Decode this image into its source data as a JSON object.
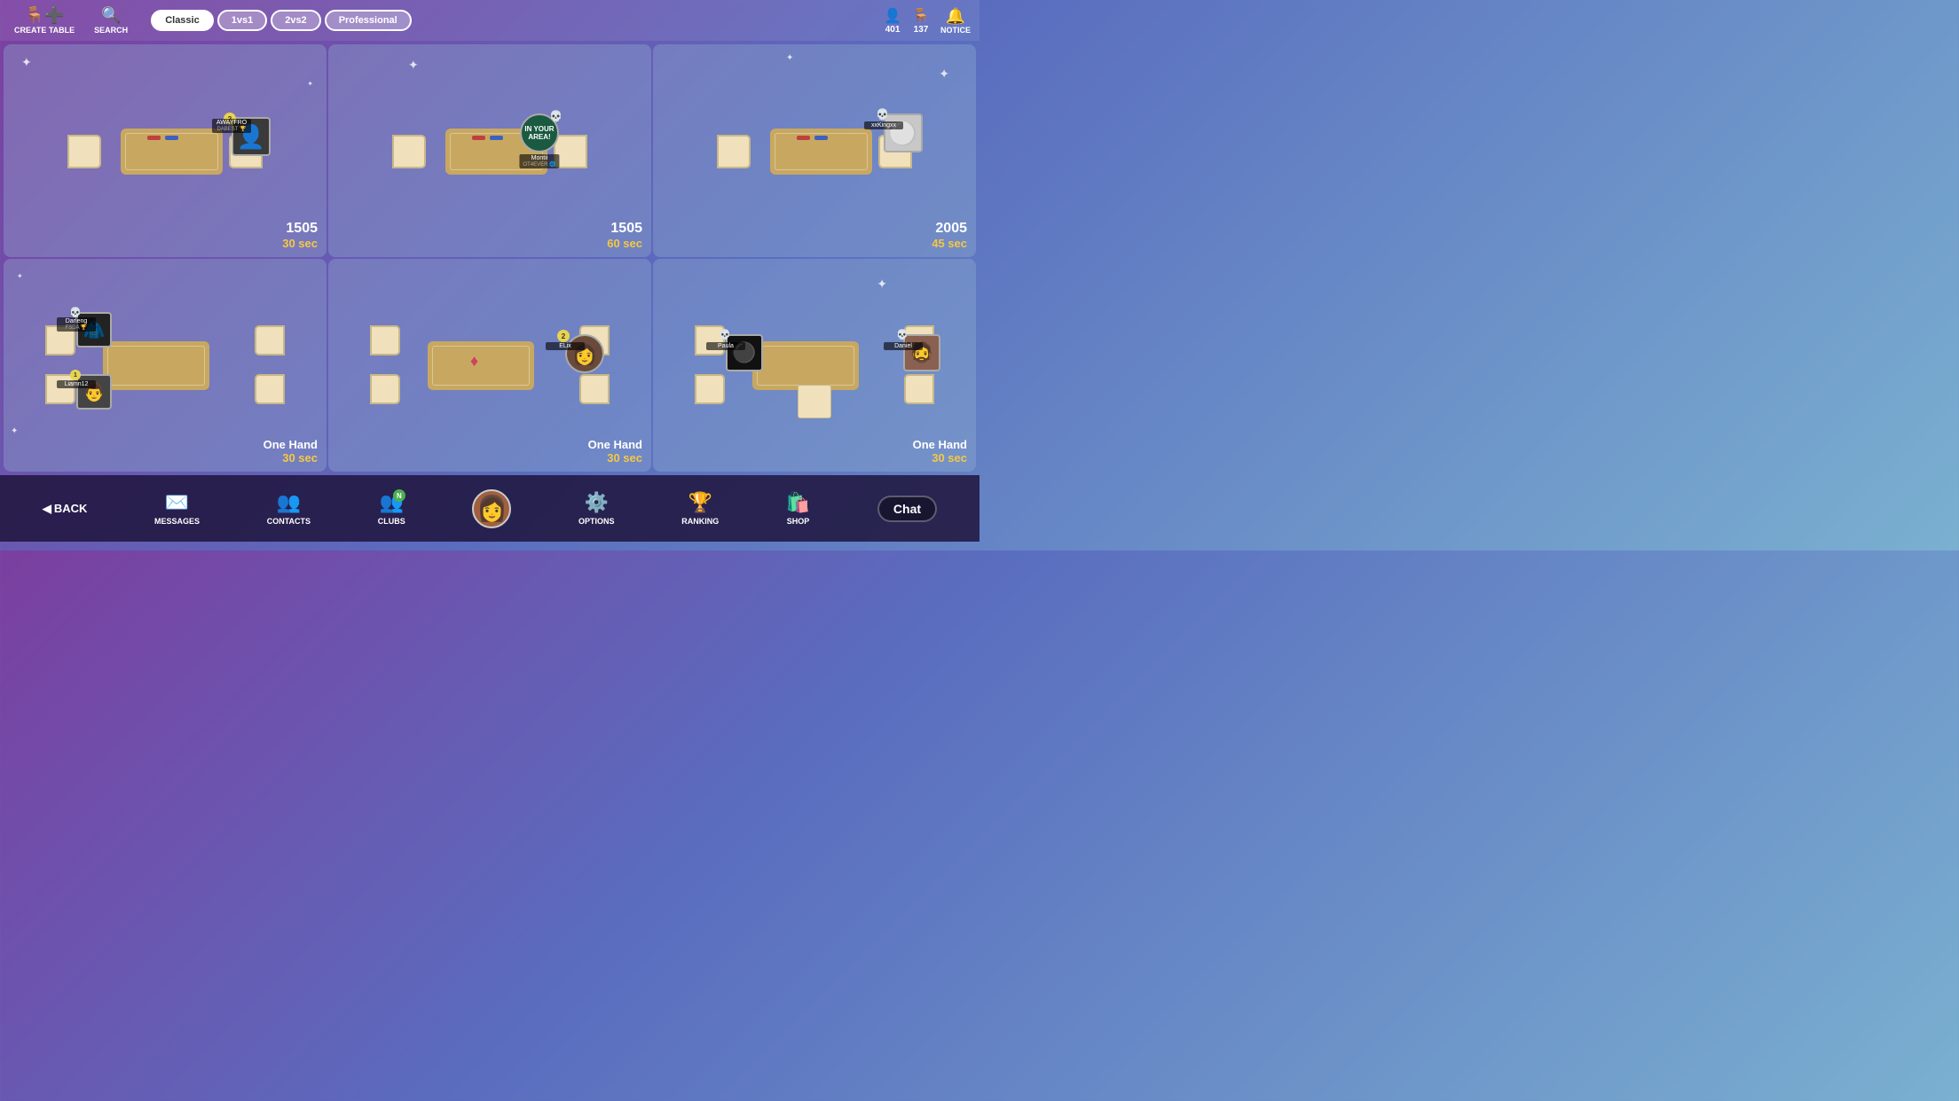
{
  "topBar": {
    "createTable": "CREATE TABLE",
    "search": "SEARCH",
    "modes": [
      "Classic",
      "1vs1",
      "2vs2",
      "Professional"
    ],
    "activeMode": "Classic",
    "friends": "401",
    "friendsIcon": "👤",
    "tables": "137",
    "tablesIcon": "🪑",
    "notice": "NOTICE",
    "noticeIcon": "🔔"
  },
  "tables": [
    {
      "id": "t1",
      "row": 0,
      "col": 0,
      "score": "1505",
      "time": "30 sec",
      "mode": "",
      "players": [
        {
          "name": "AWAYFRO",
          "subtitle": "DABEST",
          "pos": "right",
          "hasSkull": false,
          "badgeNum": 2,
          "avatar": "silhouette"
        }
      ]
    },
    {
      "id": "t2",
      "row": 0,
      "col": 1,
      "score": "1505",
      "time": "60 sec",
      "mode": "",
      "players": [
        {
          "name": "Montii",
          "subtitle": "OT4EVER",
          "pos": "right",
          "hasSkull": true,
          "badgeNum": 0,
          "avatar": "club"
        }
      ]
    },
    {
      "id": "t3",
      "row": 0,
      "col": 2,
      "score": "2005",
      "time": "45 sec",
      "mode": "",
      "players": [
        {
          "name": "xxKingxx",
          "subtitle": "",
          "pos": "right",
          "hasSkull": true,
          "badgeNum": 0,
          "avatar": "gray"
        }
      ]
    },
    {
      "id": "t4",
      "row": 1,
      "col": 0,
      "score": "",
      "time": "30 sec",
      "mode": "One Hand",
      "players": [
        {
          "name": "Darleng",
          "subtitle": "FSDA",
          "pos": "left",
          "hasSkull": true,
          "badgeNum": 0,
          "avatar": "dark"
        },
        {
          "name": "Liamn12",
          "subtitle": "",
          "pos": "left2",
          "hasSkull": false,
          "badgeNum": 1,
          "avatar": "man"
        }
      ]
    },
    {
      "id": "t5",
      "row": 1,
      "col": 1,
      "score": "",
      "time": "30 sec",
      "mode": "One Hand",
      "players": [
        {
          "name": "ELix",
          "subtitle": "",
          "pos": "right",
          "hasSkull": false,
          "badgeNum": 2,
          "avatar": "woman"
        }
      ]
    },
    {
      "id": "t6",
      "row": 1,
      "col": 2,
      "score": "",
      "time": "30 sec",
      "mode": "One Hand",
      "players": [
        {
          "name": "Paula",
          "subtitle": "",
          "pos": "left",
          "hasSkull": true,
          "badgeNum": 0,
          "avatar": "black"
        },
        {
          "name": "Daniel",
          "subtitle": "",
          "pos": "right",
          "hasSkull": true,
          "badgeNum": 0,
          "avatar": "tattoo"
        }
      ]
    }
  ],
  "bottomNav": {
    "back": "BACK",
    "messages": "MESSAGES",
    "contacts": "CONTACTS",
    "clubs": "CLUBS",
    "clubsBadge": "N",
    "options": "OPTIONS",
    "ranking": "RANKING",
    "shop": "SHOP",
    "chat": "Chat"
  }
}
